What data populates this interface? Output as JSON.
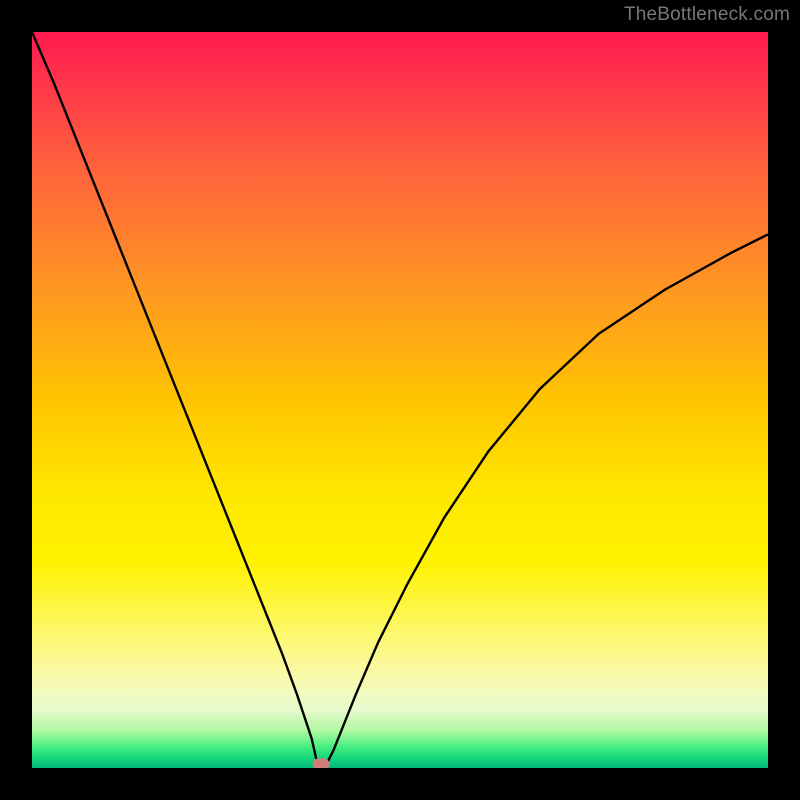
{
  "watermark": "TheBottleneck.com",
  "colors": {
    "curve": "#000000",
    "marker": "#cf7d79",
    "background": "#000000"
  },
  "chart_data": {
    "type": "line",
    "title": "",
    "xlabel": "",
    "ylabel": "",
    "xlim": [
      0,
      100
    ],
    "ylim": [
      0,
      100
    ],
    "grid": false,
    "legend": false,
    "series": [
      {
        "name": "bottleneck-curve",
        "x": [
          0,
          3,
          6,
          9,
          12,
          15,
          18,
          21,
          24,
          27,
          30,
          32,
          34,
          36,
          38,
          38.9,
          40,
          41,
          42,
          44,
          47,
          51,
          56,
          62,
          69,
          77,
          86,
          95,
          100
        ],
        "y": [
          100,
          93,
          85.5,
          78,
          70.5,
          63,
          55.5,
          48,
          40.5,
          33,
          25.5,
          20.5,
          15.5,
          10,
          4,
          0,
          0.5,
          2.5,
          5,
          10,
          17,
          25,
          34,
          43,
          51.5,
          59,
          65,
          70,
          72.5
        ]
      }
    ],
    "annotations": [
      {
        "name": "optimal-marker",
        "x": 39.3,
        "y": 0.5
      }
    ]
  }
}
